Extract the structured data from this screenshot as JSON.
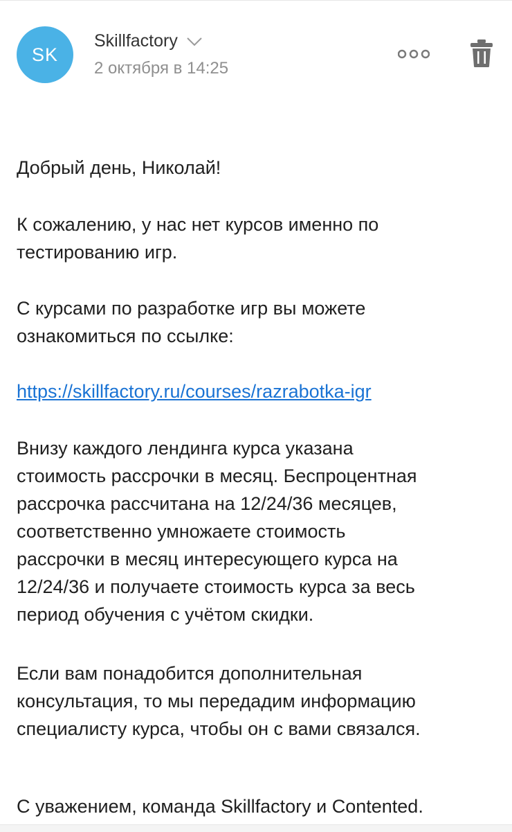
{
  "email": {
    "avatar_initials": "SK",
    "sender": "Skillfactory",
    "date": "2 октября в 14:25",
    "icons": {
      "more": "more-horizontal-icon",
      "delete": "trash-icon",
      "expand": "chevron-down-icon"
    },
    "colors": {
      "avatar": "#4ab2e6",
      "link": "#1a73d4",
      "meta": "#8f8f8f"
    },
    "body": {
      "greeting": "Добрый день, Николай!",
      "sorry_line1": "К сожалению, у нас нет курсов именно по",
      "sorry_line2": "тестированию игр.",
      "courses_line1": "С курсами по разработке игр вы можете",
      "courses_line2": "ознакомиться по ссылке:",
      "link": "https://skillfactory.ru/courses/razrabotka-igr",
      "price_line1": "Внизу каждого лендинга курса указана",
      "price_line2": "стоимость рассрочки в месяц. Беспроцентная",
      "price_line3": "рассрочка рассчитана на 12/24/36 месяцев,",
      "price_line4": "соответственно умножаете стоимость",
      "price_line5": "рассрочки в месяц интересующего курса на",
      "price_line6": "12/24/36 и получаете стоимость курса за весь",
      "price_line7": "период обучения с учётом скидки.",
      "consult_line1": "Если вам понадобится дополнительная",
      "consult_line2": "консультация, то мы передадим информацию",
      "consult_line3": "специалисту курса, чтобы он с вами связался.",
      "signature": "С уважением, команда Skillfactory и Contented."
    }
  }
}
